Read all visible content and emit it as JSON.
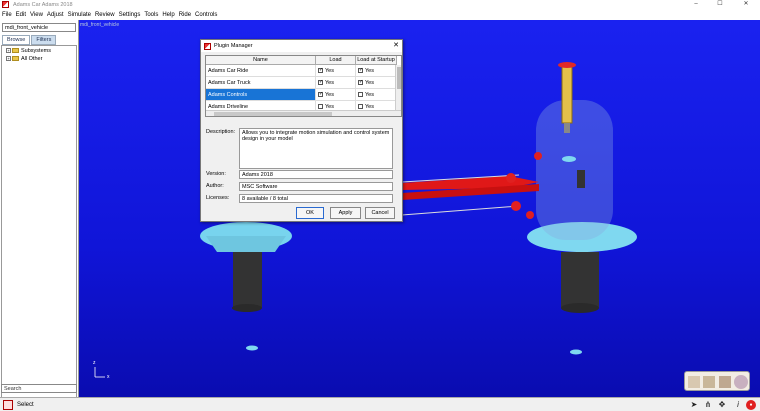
{
  "window": {
    "title": "Adams Car Adams 2018",
    "minimize": "–",
    "maximize": "☐",
    "close": "✕"
  },
  "menu": [
    "File",
    "Edit",
    "View",
    "Adjust",
    "Simulate",
    "Review",
    "Settings",
    "Tools",
    "Help",
    "Ride",
    "Controls"
  ],
  "left_panel": {
    "model_name": "mdi_front_vehicle",
    "tabs": [
      "Browse",
      "Filters"
    ],
    "tree": [
      {
        "label": "Subsystems"
      },
      {
        "label": "All Other"
      }
    ],
    "search_placeholder": "Search"
  },
  "viewport": {
    "label": "mdi_front_vehicle",
    "axis_y": "z",
    "axis_x": "x"
  },
  "dialog": {
    "title": "Plugin Manager",
    "close": "✕",
    "columns": [
      "Name",
      "Load",
      "Load at Startup"
    ],
    "rows": [
      {
        "name": "Adams Car Ride",
        "load": "Yes",
        "load_checked": true,
        "startup": "Yes",
        "startup_checked": true
      },
      {
        "name": "Adams Car Truck",
        "load": "Yes",
        "load_checked": true,
        "startup": "Yes",
        "startup_checked": true
      },
      {
        "name": "Adams Controls",
        "load": "Yes",
        "load_checked": true,
        "startup": "Yes",
        "startup_checked": false
      },
      {
        "name": "Adams Driveline",
        "load": "Yes",
        "load_checked": false,
        "startup": "Yes",
        "startup_checked": false
      }
    ],
    "selected_row": 2,
    "description_label": "Description:",
    "description": "Allows you to integrate motion simulation and control system design in your model",
    "version_label": "Version:",
    "version": "Adams 2018",
    "author_label": "Author:",
    "author": "MSC Software",
    "licenses_label": "Licenses:",
    "licenses": "8 available / 8 total",
    "ok": "OK",
    "apply": "Apply",
    "cancel": "Cancel"
  },
  "status": {
    "text": "Select",
    "info": "i"
  },
  "colors": {
    "viewport": "#1418e0",
    "selection": "#1874d6",
    "arm": "#e01818",
    "wheel_pad": "#7fd8f0"
  }
}
